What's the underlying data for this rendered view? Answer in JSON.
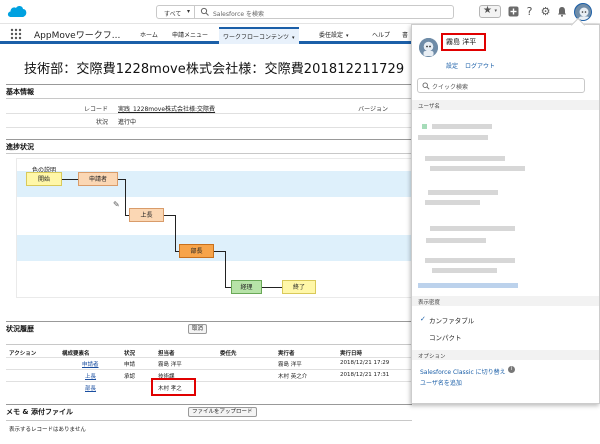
{
  "header": {
    "search_scope": "すべて",
    "search_placeholder": "Salesforce を検索",
    "help_glyph": "?"
  },
  "nav": {
    "app_name": "AppMoveワークフ...",
    "tabs": [
      {
        "label": "ホーム",
        "chevron": false
      },
      {
        "label": "申請メニュー",
        "chevron": false
      },
      {
        "label": "ワークフローコンテンツ",
        "chevron": true,
        "active": true
      },
      {
        "label": "委任設定",
        "chevron": true
      },
      {
        "label": "ヘルプ",
        "chevron": false
      },
      {
        "label": "書",
        "chevron": false
      }
    ]
  },
  "page_title": "技術部：交際費1228move株式会社様：交際費201812211729",
  "basic_info": {
    "title": "基本情報",
    "record_label": "レコード",
    "record_value": "実践_1228move株式会社様:交際費",
    "status_label": "状況",
    "status_value": "進行中",
    "version_label": "バージョン"
  },
  "progress": {
    "title": "進捗状況",
    "legend": "色の説明",
    "nodes": [
      "開始",
      "申請者",
      "上長",
      "部長",
      "経理",
      "終了"
    ]
  },
  "history": {
    "title": "状況履歴",
    "cancel_button": "取消",
    "columns": [
      "アクション",
      "構成要素名",
      "状況",
      "担当者",
      "委任先",
      "実行者",
      "実行日時"
    ],
    "rows": [
      {
        "element": "申請者",
        "status": "申請",
        "assignee": "霧島 洋平",
        "delegate": "",
        "executor": "霧島 洋平",
        "datetime": "2018/12/21 17:29"
      },
      {
        "element": "上長",
        "status": "承認",
        "assignee": "技術課",
        "delegate": "",
        "executor": "木村 英之介",
        "datetime": "2018/12/21 17:31"
      },
      {
        "element": "部長",
        "status": "",
        "assignee": "木村 孝之",
        "delegate": "",
        "executor": "",
        "datetime": ""
      }
    ]
  },
  "notes": {
    "title": "メモ & 添付ファイル",
    "upload_button": "ファイルをアップロード",
    "empty_text": "表示するレコードはありません"
  },
  "profile_panel": {
    "user_name": "霧島 洋平",
    "settings_link": "設定",
    "logout_link": "ログアウト",
    "quick_search_placeholder": "クイック検索",
    "username_header": "ユーザ名",
    "density_header": "表示密度",
    "density_options": [
      {
        "label": "カンファタブル",
        "selected": true
      },
      {
        "label": "コンパクト",
        "selected": false
      }
    ],
    "options_header": "オプション",
    "switch_classic": "Salesforce Classic に切り替え",
    "add_username": "ユーザ名を追加"
  },
  "colors": {
    "brand_blue": "#1b5fa8",
    "highlight_red": "#e00000",
    "band_blue": "#def0fb",
    "node_start": "#fff7a8",
    "node_done": "#fbd7b4",
    "node_current": "#f7a44a",
    "node_todo": "#b7e3a8"
  }
}
